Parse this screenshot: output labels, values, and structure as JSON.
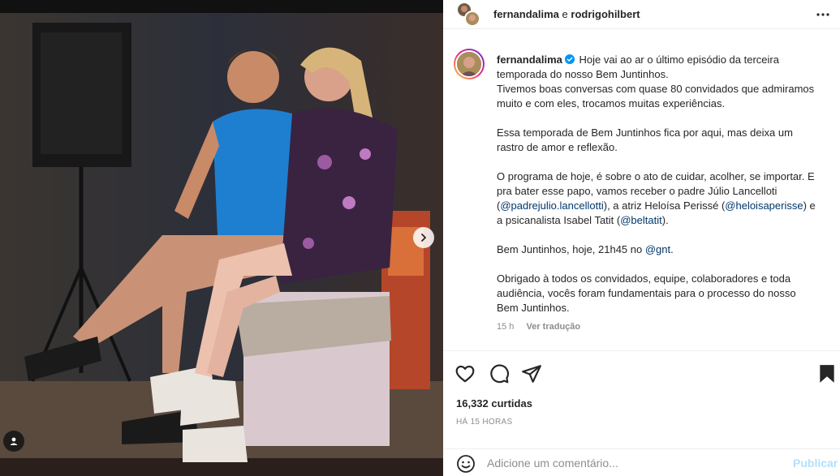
{
  "header": {
    "user1": "fernandalima",
    "separator": " e ",
    "user2": "rodrigohilbert"
  },
  "caption": {
    "username": "fernandalima",
    "lines": [
      "Hoje vai ao ar o último episódio da terceira temporada do nosso Bem Juntinhos.",
      "Tivemos boas conversas com quase 80 convidados que admiramos muito e com eles, trocamos muitas experiências."
    ],
    "p2": "Essa temporada de Bem Juntinhos fica por aqui, mas deixa um rastro de amor e reflexão.",
    "p3_a": "O programa de hoje, é sobre o ato de cuidar, acolher, se importar. E pra bater esse papo, vamos receber o padre Júlio Lancelloti (",
    "p3_m1": "@padrejulio.lancellotti",
    "p3_b": "), a atriz Heloísa Perissé (",
    "p3_m2": "@heloisaperisse",
    "p3_c": ") e a psicanalista Isabel Tatit (",
    "p3_m3": "@beltatit",
    "p3_d": ").",
    "p4_a": "Bem Juntinhos, hoje, 21h45 no ",
    "p4_m": "@gnt",
    "p4_b": ".",
    "p5": "Obrigado à todos os convidados, equipe, colaboradores e toda audiência, vocês foram fundamentais para o processo do nosso Bem Juntinhos.",
    "age": "15 h",
    "translate": "Ver tradução"
  },
  "stats": {
    "likes": "16,332 curtidas",
    "time": "HÁ 15 HORAS"
  },
  "comment": {
    "placeholder": "Adicione um comentário...",
    "publish": "Publicar"
  },
  "colors": {
    "mention": "#00376b",
    "muted": "#8e8e8e",
    "publish_disabled": "#b2dffc",
    "verified": "#0095f6"
  },
  "icons": [
    "more-icon",
    "verified-badge-icon",
    "heart-icon",
    "comment-icon",
    "share-icon",
    "bookmark-icon",
    "emoji-icon",
    "chevron-right-icon",
    "user-tag-icon"
  ]
}
